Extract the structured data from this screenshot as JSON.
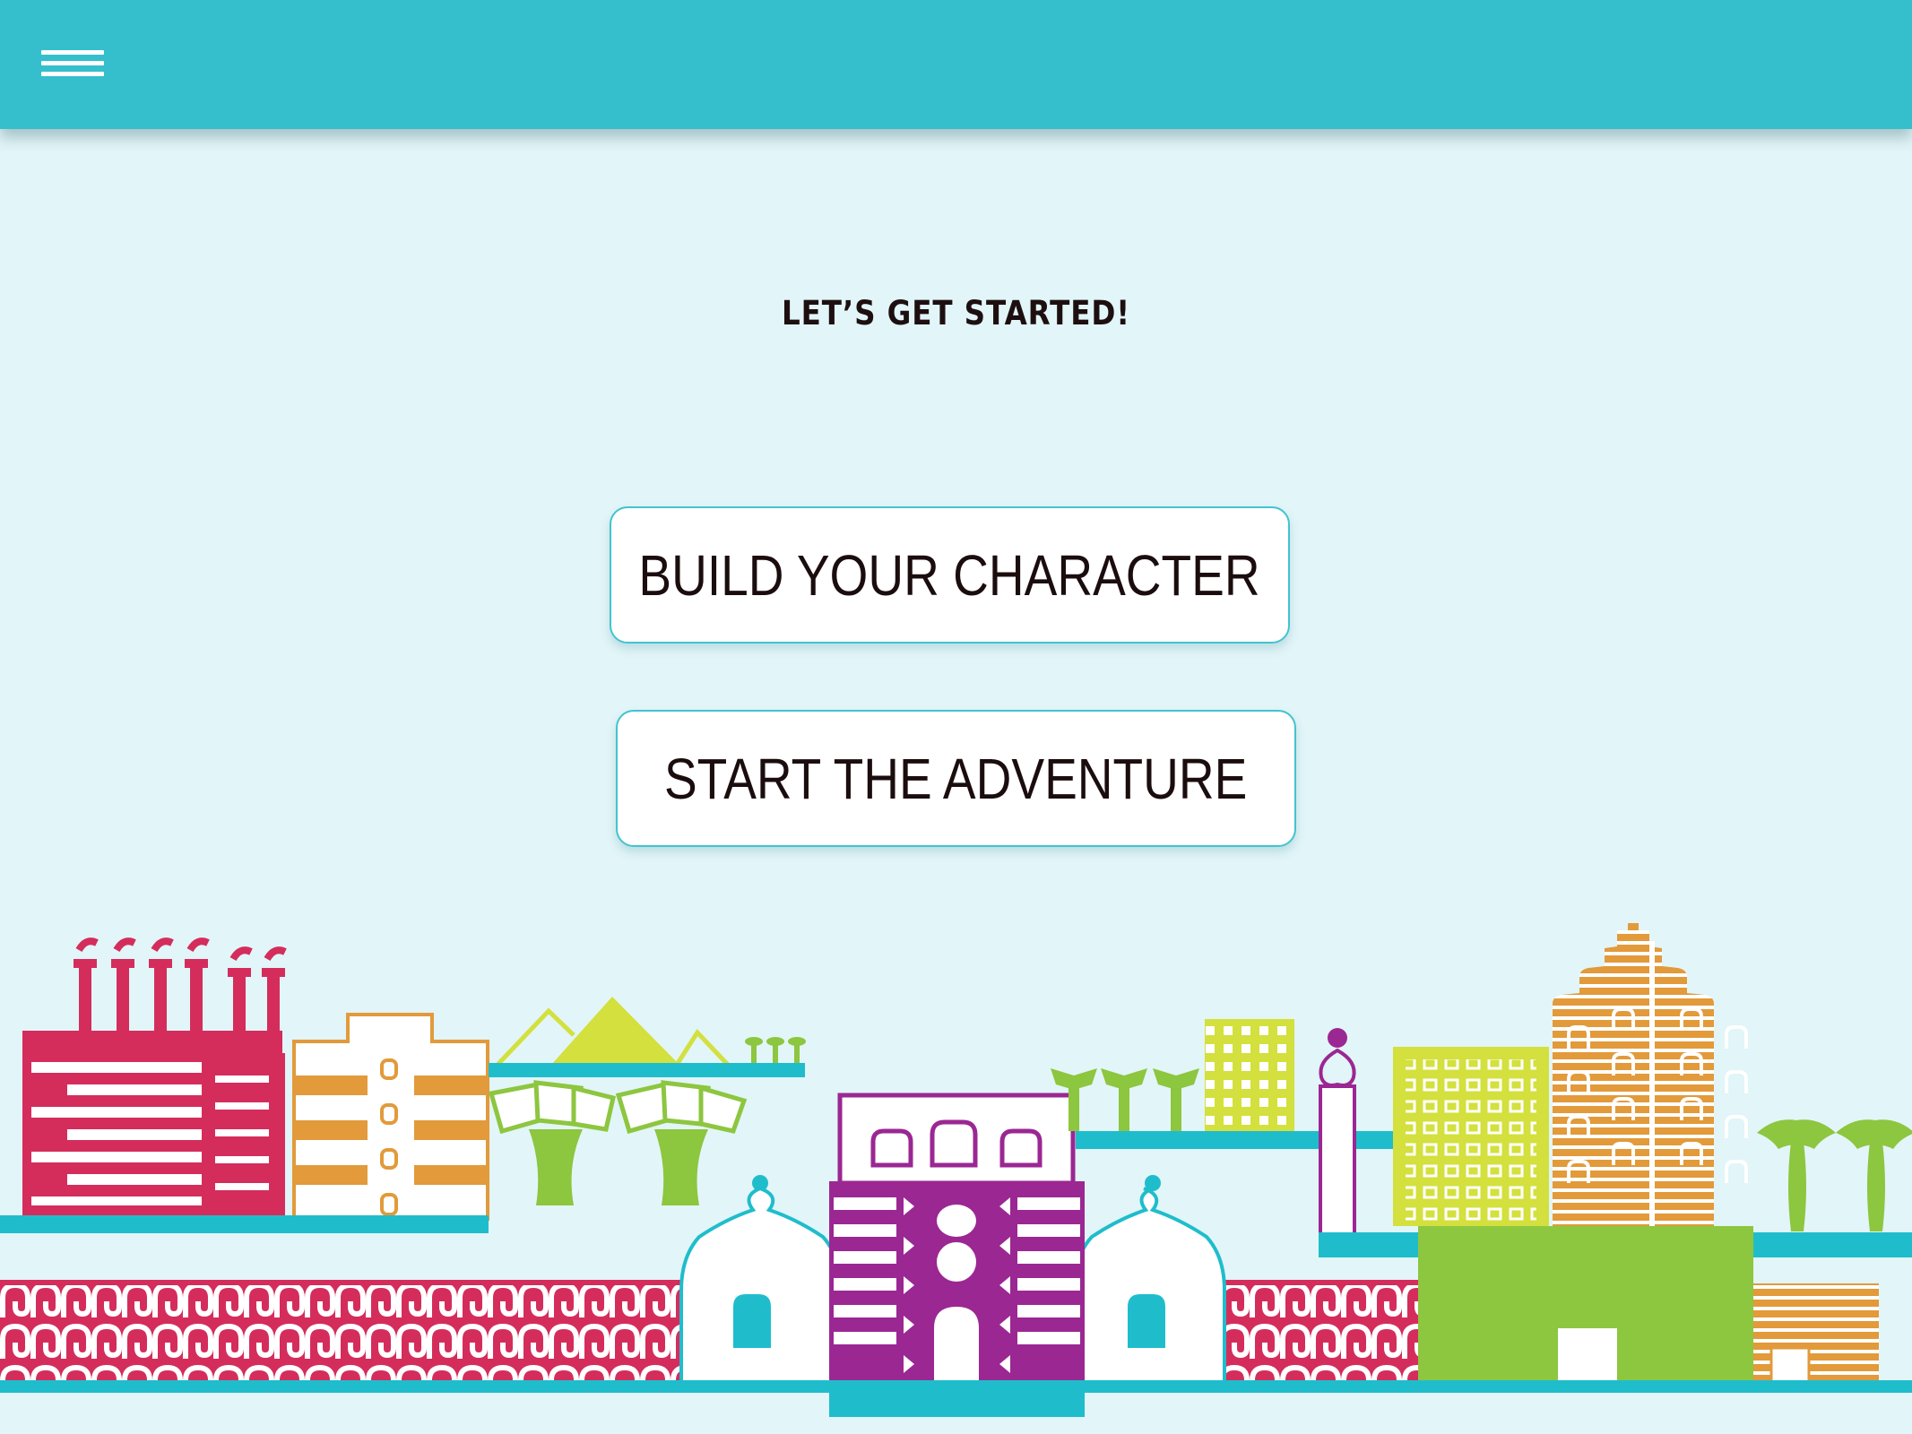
{
  "header": {
    "menu_icon": "hamburger-menu-icon"
  },
  "main": {
    "heading": "LET’S GET STARTED!",
    "buttons": [
      {
        "label": "BUILD YOUR CHARACTER"
      },
      {
        "label": "START THE ADVENTURE"
      }
    ]
  },
  "illustration": {
    "name": "city-skyline-illustration"
  },
  "colors": {
    "header": "#35bfcd",
    "background": "#e2f5f8",
    "button_border": "#43c3d0",
    "text": "#1b0d0e",
    "crimson": "#d42d5c",
    "orange": "#e29a3a",
    "lime": "#d3e03d",
    "green": "#8dc63f",
    "purple": "#9b2793",
    "teal": "#1fbdcc"
  }
}
